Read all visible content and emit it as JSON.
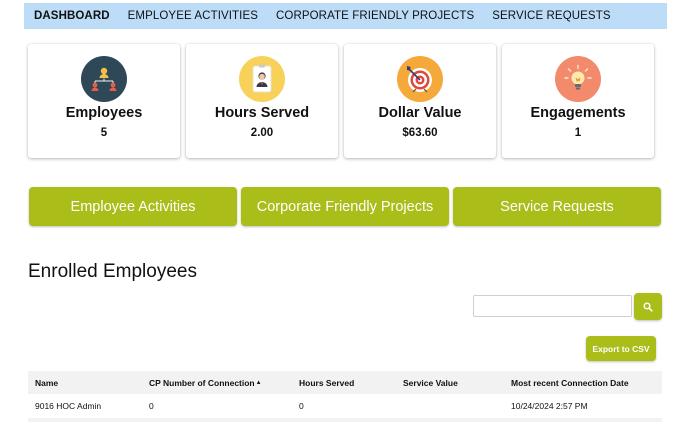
{
  "nav": {
    "items": [
      {
        "label": "DASHBOARD"
      },
      {
        "label": "EMPLOYEE ACTIVITIES"
      },
      {
        "label": "CORPORATE FRIENDLY PROJECTS"
      },
      {
        "label": "SERVICE REQUESTS"
      }
    ],
    "active_index": 0
  },
  "stats": [
    {
      "title": "Employees",
      "value": "5",
      "icon": "org-chart-icon",
      "icon_bg": "#2f4858"
    },
    {
      "title": "Hours Served",
      "value": "2.00",
      "icon": "id-badge-icon",
      "icon_bg": "#f7d15a"
    },
    {
      "title": "Dollar Value",
      "value": "$63.60",
      "icon": "target-icon",
      "icon_bg": "#f6a93b"
    },
    {
      "title": "Engagements",
      "value": "1",
      "icon": "lightbulb-icon",
      "icon_bg": "#f48a6c"
    }
  ],
  "buttons": {
    "employee_activities": "Employee Activities",
    "corporate_projects": "Corporate Friendly Projects",
    "service_requests": "Service Requests",
    "export_csv": "Export to CSV"
  },
  "section_title": "Enrolled Employees",
  "search": {
    "value": "",
    "placeholder": ""
  },
  "table": {
    "headers": [
      "Name",
      "CP Number of Connection",
      "Hours Served",
      "Service Value",
      "Most recent Connection Date"
    ],
    "sorted_column": 1,
    "rows": [
      [
        "9016 HOC Admin",
        "0",
        "0",
        "",
        "10/24/2024 2:57 PM"
      ]
    ]
  },
  "colors": {
    "accent": "#aabd19",
    "nav_bg": "#bcdcf7"
  }
}
